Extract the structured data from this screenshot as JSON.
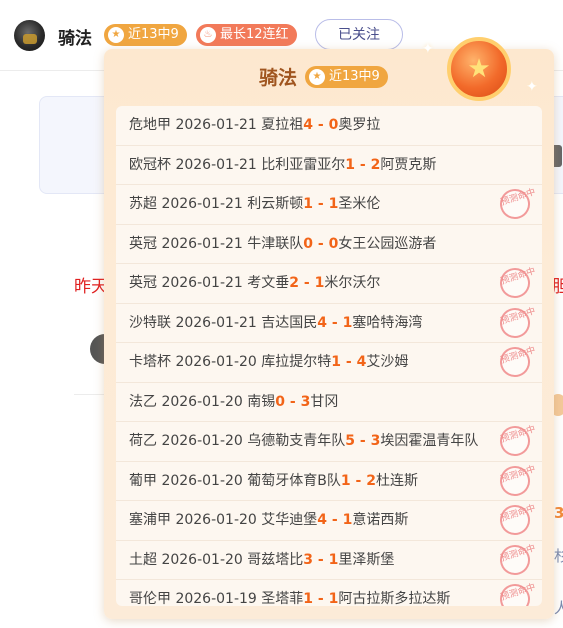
{
  "header": {
    "username": "骑法",
    "streak_badge": "近13中9",
    "longest_badge": "最长12连红",
    "follow_label": "已关注"
  },
  "background": {
    "red_left": "昨天",
    "red_right": "胆",
    "orange_right": "3",
    "tail1": "杉",
    "tail2": "人"
  },
  "popover": {
    "name": "骑法",
    "badge": "近13中9",
    "stamp_text": "预测命中",
    "rows": [
      {
        "league": "危地甲",
        "date": "2026-01-21",
        "home": "夏拉祖",
        "hs": "4",
        "sep": " - ",
        "as": "0",
        "away": "奥罗拉",
        "hit": false
      },
      {
        "league": "欧冠杯",
        "date": "2026-01-21",
        "home": "比利亚雷亚尔",
        "hs": "1",
        "sep": " - ",
        "as": "2",
        "away": "阿贾克斯",
        "hit": false
      },
      {
        "league": "苏超",
        "date": "2026-01-21",
        "home": "利云斯顿",
        "hs": "1",
        "sep": " - ",
        "as": "1",
        "away": "圣米伦",
        "hit": true
      },
      {
        "league": "英冠",
        "date": "2026-01-21",
        "home": "牛津联队",
        "hs": "0",
        "sep": " - ",
        "as": "0",
        "away": "女王公园巡游者",
        "hit": false
      },
      {
        "league": "英冠",
        "date": "2026-01-21",
        "home": "考文垂",
        "hs": "2",
        "sep": " - ",
        "as": "1",
        "away": "米尔沃尔",
        "hit": true
      },
      {
        "league": "沙特联",
        "date": "2026-01-21",
        "home": "吉达国民",
        "hs": "4",
        "sep": " - ",
        "as": "1",
        "away": "塞哈特海湾",
        "hit": true
      },
      {
        "league": "卡塔杯",
        "date": "2026-01-20",
        "home": "库拉提尔特",
        "hs": "1",
        "sep": " - ",
        "as": "4",
        "away": "艾沙姆",
        "hit": true
      },
      {
        "league": "法乙",
        "date": "2026-01-20",
        "home": "南锡",
        "hs": "0",
        "sep": " - ",
        "as": "3",
        "away": "甘冈",
        "hit": false
      },
      {
        "league": "荷乙",
        "date": "2026-01-20",
        "home": "乌德勒支青年队",
        "hs": "5",
        "sep": " - ",
        "as": "3",
        "away": "埃因霍温青年队",
        "hit": true
      },
      {
        "league": "葡甲",
        "date": "2026-01-20",
        "home": "葡萄牙体育B队",
        "hs": "1",
        "sep": " - ",
        "as": "2",
        "away": "杜连斯",
        "hit": true
      },
      {
        "league": "塞浦甲",
        "date": "2026-01-20",
        "home": "艾华迪堡",
        "hs": "4",
        "sep": " - ",
        "as": "1",
        "away": "意诺西斯",
        "hit": true
      },
      {
        "league": "土超",
        "date": "2026-01-20",
        "home": "哥兹塔比",
        "hs": "3",
        "sep": " - ",
        "as": "1",
        "away": "里泽斯堡",
        "hit": true
      },
      {
        "league": "哥伦甲",
        "date": "2026-01-19",
        "home": "圣塔菲",
        "hs": "1",
        "sep": " - ",
        "as": "1",
        "away": "阿古拉斯多拉达斯",
        "hit": true
      }
    ]
  }
}
